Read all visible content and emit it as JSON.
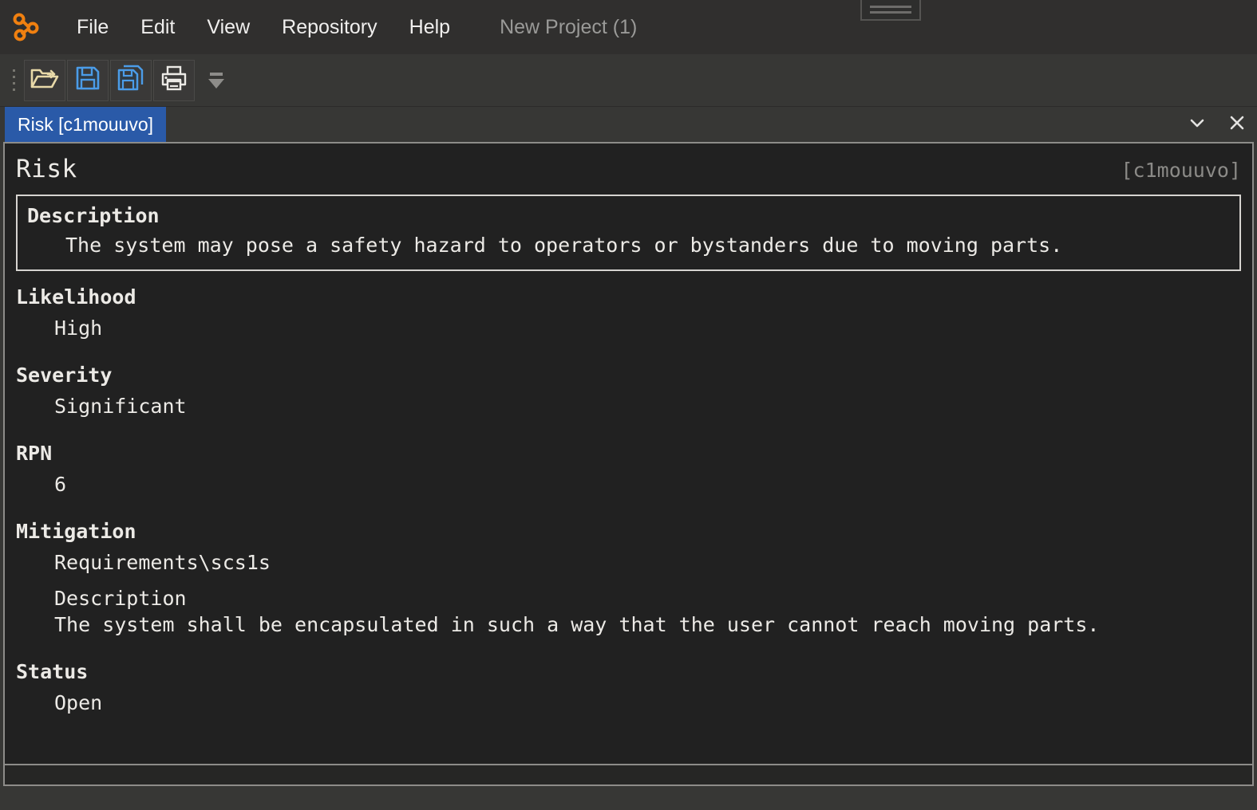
{
  "app": {
    "logo_icon": "node-graph-logo-icon",
    "accent_orange": "#f08010",
    "tab_blue": "#2a5aa8",
    "panel_bg": "#212121",
    "chrome_bg": "#373735"
  },
  "menubar": {
    "items": [
      {
        "label": "File",
        "name": "menu-file"
      },
      {
        "label": "Edit",
        "name": "menu-edit"
      },
      {
        "label": "View",
        "name": "menu-view"
      },
      {
        "label": "Repository",
        "name": "menu-repository"
      },
      {
        "label": "Help",
        "name": "menu-help"
      }
    ],
    "project_label": "New Project (1)"
  },
  "toolbar": {
    "buttons": [
      {
        "label": "Open",
        "icon": "open-folder-icon",
        "name": "open-button"
      },
      {
        "label": "Save",
        "icon": "save-floppy-icon",
        "name": "save-button"
      },
      {
        "label": "Save As",
        "icon": "save-as-floppy-icon",
        "name": "save-as-button"
      },
      {
        "label": "Print",
        "icon": "printer-icon",
        "name": "print-button"
      }
    ],
    "overflow_icon": "toolbar-overflow-chevron-icon"
  },
  "tabs": {
    "items": [
      {
        "label": "Risk [c1mouuvo]",
        "active": true
      }
    ],
    "list_icon": "chevron-down-icon",
    "close_icon": "close-icon"
  },
  "document": {
    "title": "Risk",
    "id": "[c1mouuvo]",
    "description": {
      "label": "Description",
      "value": "The system may pose a safety hazard to operators or bystanders due to moving parts."
    },
    "likelihood": {
      "label": "Likelihood",
      "value": "High"
    },
    "severity": {
      "label": "Severity",
      "value": "Significant"
    },
    "rpn": {
      "label": "RPN",
      "value": "6"
    },
    "mitigation": {
      "label": "Mitigation",
      "value": "Requirements\\scs1s",
      "sub_label": "Description",
      "sub_value": "The system shall be encapsulated in such a way that the user cannot reach moving parts."
    },
    "status": {
      "label": "Status",
      "value": "Open"
    }
  }
}
